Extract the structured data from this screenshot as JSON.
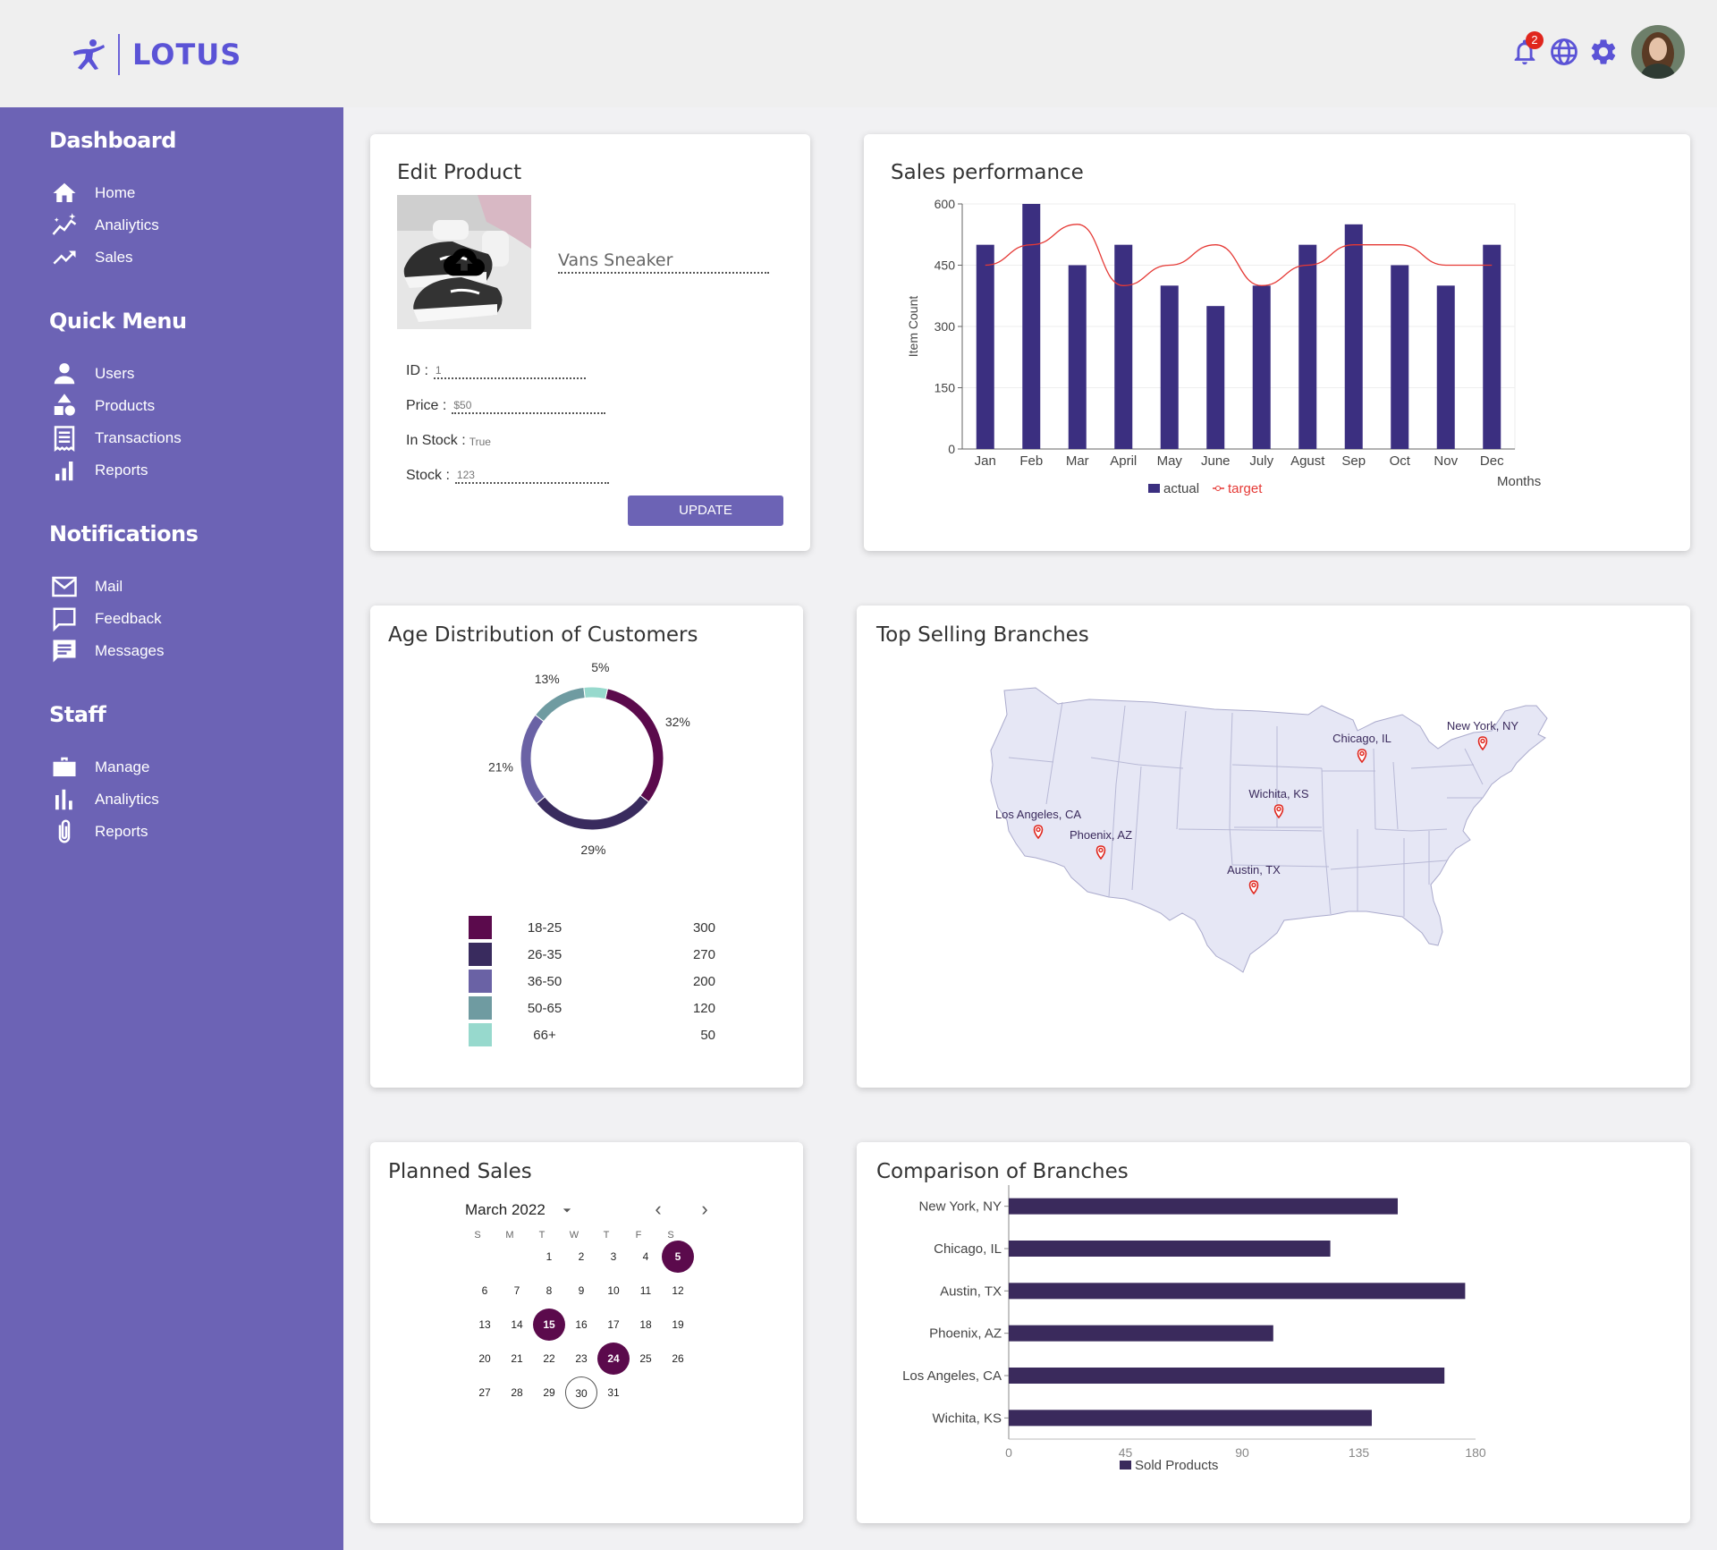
{
  "app": {
    "name": "LOTUS"
  },
  "topbar": {
    "notification_count": "2",
    "icons": [
      "bell-icon",
      "globe-icon",
      "gear-icon",
      "avatar"
    ]
  },
  "sidebar": {
    "sections": [
      {
        "title": "Dashboard",
        "items": [
          {
            "label": "Home",
            "icon": "home-icon"
          },
          {
            "label": "Analiytics",
            "icon": "analytics-icon"
          },
          {
            "label": "Sales",
            "icon": "trending-icon"
          }
        ]
      },
      {
        "title": "Quick Menu",
        "items": [
          {
            "label": "Users",
            "icon": "user-icon"
          },
          {
            "label": "Products",
            "icon": "shapes-icon"
          },
          {
            "label": "Transactions",
            "icon": "receipt-icon"
          },
          {
            "label": "Reports",
            "icon": "bar-chart-icon"
          }
        ]
      },
      {
        "title": "Notifications",
        "items": [
          {
            "label": "Mail",
            "icon": "mail-icon"
          },
          {
            "label": "Feedback",
            "icon": "feedback-icon"
          },
          {
            "label": "Messages",
            "icon": "message-icon"
          }
        ]
      },
      {
        "title": "Staff",
        "items": [
          {
            "label": "Manage",
            "icon": "briefcase-icon"
          },
          {
            "label": "Analiytics",
            "icon": "analytics-bars-icon"
          },
          {
            "label": "Reports",
            "icon": "paperclip-icon"
          }
        ]
      }
    ]
  },
  "edit_product": {
    "title": "Edit Product",
    "name": "Vans Sneaker",
    "fields": [
      {
        "label": "ID :",
        "value": "1"
      },
      {
        "label": "Price :",
        "value": "$50"
      },
      {
        "label": "In Stock :",
        "value": "True"
      },
      {
        "label": "Stock :",
        "value": "123"
      }
    ],
    "button": "UPDATE"
  },
  "sales_performance": {
    "title": "Sales performance",
    "chart_data": {
      "type": "bar",
      "categories": [
        "Jan",
        "Feb",
        "Mar",
        "April",
        "May",
        "June",
        "July",
        "Agust",
        "Sep",
        "Oct",
        "Nov",
        "Dec"
      ],
      "series": [
        {
          "name": "actual",
          "type": "bar",
          "values": [
            500,
            600,
            450,
            500,
            400,
            350,
            400,
            500,
            550,
            450,
            400,
            500
          ]
        },
        {
          "name": "target",
          "type": "line",
          "values": [
            450,
            500,
            550,
            400,
            450,
            500,
            400,
            450,
            500,
            500,
            450,
            450
          ]
        }
      ],
      "ylabel": "Item Count",
      "xlabel": "Months",
      "ylim": [
        0,
        600
      ],
      "yticks": [
        "0",
        "150",
        "300",
        "450",
        "600"
      ],
      "colors": {
        "actual": "#3b2f80",
        "target": "#e53935"
      },
      "legend": "bottom"
    }
  },
  "age_distribution": {
    "title": "Age Distribution of Customers",
    "chart_data": {
      "type": "pie",
      "categories": [
        "18-25",
        "26-35",
        "36-50",
        "50-65",
        "66+"
      ],
      "values": [
        300,
        270,
        200,
        120,
        50
      ],
      "percent_labels": [
        "32%",
        "29%",
        "21%",
        "13%",
        "5%"
      ],
      "colors": [
        "#5b0a4c",
        "#392b5e",
        "#6a62a5",
        "#6f9ba1",
        "#97d9cd"
      ]
    }
  },
  "top_branches": {
    "title": "Top Selling Branches",
    "branches": [
      "Chicago, IL",
      "New York, NY",
      "Wichita, KS",
      "Los Angeles, CA",
      "Phoenix, AZ",
      "Austin, TX"
    ]
  },
  "planned_sales": {
    "title": "Planned Sales",
    "month": "March 2022",
    "days_of_week": [
      "S",
      "M",
      "T",
      "W",
      "T",
      "F",
      "S"
    ],
    "first_weekday": 2,
    "num_days": 31,
    "selected": [
      5,
      15,
      24
    ],
    "today": 30
  },
  "comparison": {
    "title": "Comparison of Branches",
    "chart_data": {
      "type": "bar",
      "orientation": "horizontal",
      "categories": [
        "New York, NY",
        "Chicago, IL",
        "Austin, TX",
        "Phoenix, AZ",
        "Los Angeles, CA",
        "Wichita, KS"
      ],
      "series": [
        {
          "name": "Sold Products",
          "values": [
            150,
            124,
            176,
            102,
            168,
            140
          ]
        }
      ],
      "xlim": [
        0,
        180
      ],
      "xticks": [
        "0",
        "45",
        "90",
        "135",
        "180"
      ],
      "color": "#3a2a5c",
      "legend": "bottom"
    }
  }
}
